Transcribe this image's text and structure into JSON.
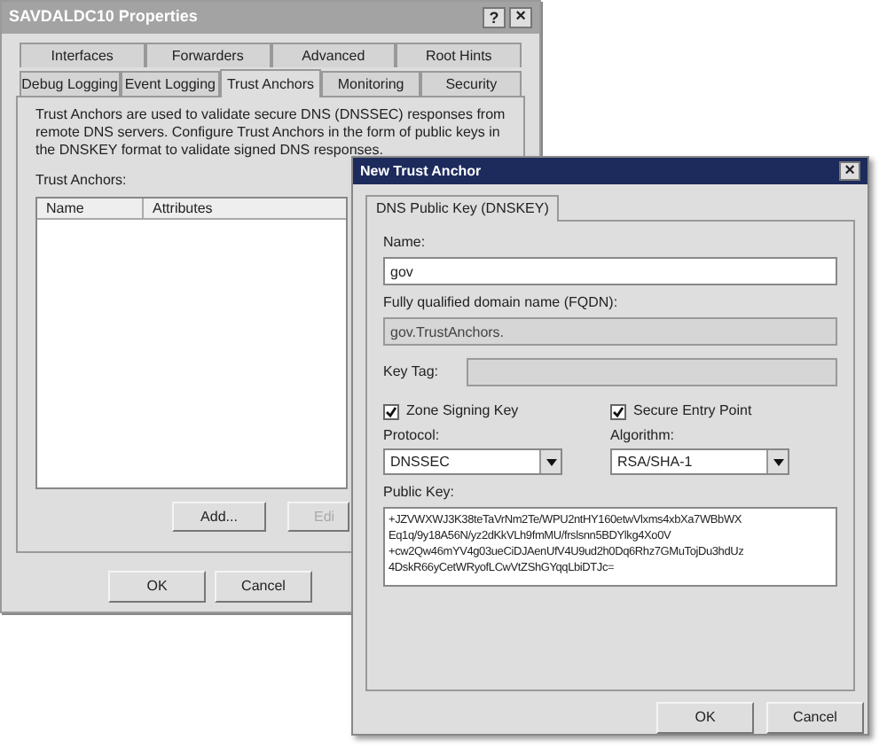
{
  "properties_window": {
    "title": "SAVDALDC10 Properties",
    "help_button": "?",
    "close_button": "×",
    "tab_rows": [
      [
        {
          "label": "Interfaces",
          "selected": false
        },
        {
          "label": "Forwarders",
          "selected": false
        },
        {
          "label": "Advanced",
          "selected": false
        },
        {
          "label": "Root Hints",
          "selected": false
        }
      ],
      [
        {
          "label": "Debug Logging",
          "selected": false
        },
        {
          "label": "Event Logging",
          "selected": false
        },
        {
          "label": "Trust Anchors",
          "selected": true
        },
        {
          "label": "Monitoring",
          "selected": false
        },
        {
          "label": "Security",
          "selected": false
        }
      ]
    ],
    "description": "Trust Anchors are used to validate secure DNS (DNSSEC) responses from remote DNS servers. Configure Trust Anchors in the form of public keys in the DNSKEY format to validate signed DNS responses.",
    "list_label": "Trust Anchors:",
    "columns": [
      "Name",
      "Attributes"
    ],
    "buttons": [
      {
        "label": "Add...",
        "disabled": false
      },
      {
        "label": "Edi",
        "disabled": true
      }
    ],
    "footer_buttons": [
      "OK",
      "Cancel"
    ]
  },
  "new_trust_anchor": {
    "title": "New Trust Anchor",
    "close_button": "×",
    "tabs": [
      {
        "label": "DNS Public Key (DNSKEY)",
        "selected": true
      }
    ],
    "name": {
      "label": "Name:",
      "value": "gov"
    },
    "fqdn": {
      "label": "Fully qualified domain name (FQDN):",
      "value": "gov.TrustAnchors.",
      "disabled": true
    },
    "key_tag": {
      "label": "Key Tag:",
      "disabled": true
    },
    "checkboxes": [
      {
        "label": "Zone Signing Key",
        "checked": true
      },
      {
        "label": "Secure Entry Point",
        "checked": true
      }
    ],
    "combos": [
      {
        "label": "Protocol:",
        "value": "DNSSEC"
      },
      {
        "label": "Algorithm:",
        "value": "RSA/SHA-1"
      }
    ],
    "public_key": {
      "label": "Public Key:",
      "lines": [
        "+JZVWXWJ3K38teTaVrNm2Te/WPU2ntHY160etwVlxms4xbXa7WBbWX",
        "Eq1q/9y18A56N/yz2dKkVLh9fmMU/frslsnn5BDYlkg4Xo0V",
        "+cw2Qw46mYV4g03ueCiDJAenUfV4U9ud2h0Dq6Rhz7GMuTojDu3hdUz",
        "4DskR66yCetWRyofLCwVtZShGYqqLbiDTJc="
      ]
    },
    "buttons": [
      "OK",
      "Cancel"
    ]
  }
}
